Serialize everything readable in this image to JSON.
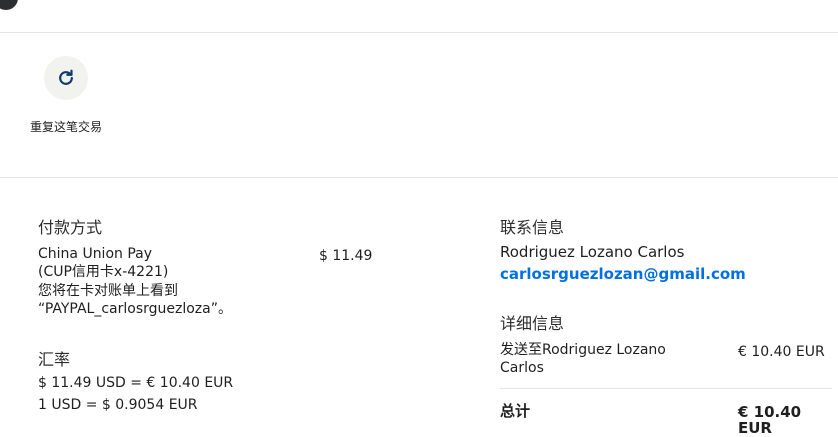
{
  "header": {
    "title": "",
    "right_link": ""
  },
  "actions": {
    "repeat_label": "重复这笔交易"
  },
  "payment": {
    "section_title": "付款方式",
    "method_line1": "China Union Pay",
    "method_line2": "(CUP信用卡x-4221)",
    "statement_line1": "您将在卡对账单上看到",
    "statement_line2": "“PAYPAL_carlosrguezloza”。",
    "amount": "$ 11.49"
  },
  "exchange": {
    "section_title": "汇率",
    "line1": "$ 11.49 USD = € 10.40 EUR",
    "line2": "1 USD = $ 0.9054 EUR"
  },
  "contact": {
    "section_title": "联系信息",
    "name": "Rodriguez Lozano Carlos",
    "email": "carlosrguezlozan@gmail.com"
  },
  "details": {
    "section_title": "详细信息",
    "sent_to_line1": "发送至Rodriguez Lozano",
    "sent_to_line2": "Carlos",
    "sent_amount": "€ 10.40 EUR",
    "total_label": "总计",
    "total_amount": "€ 10.40 EUR"
  },
  "colors": {
    "link": "#0070e0",
    "action_bg": "#f2f2ee"
  },
  "icons": {
    "repeat": "refresh-icon"
  }
}
